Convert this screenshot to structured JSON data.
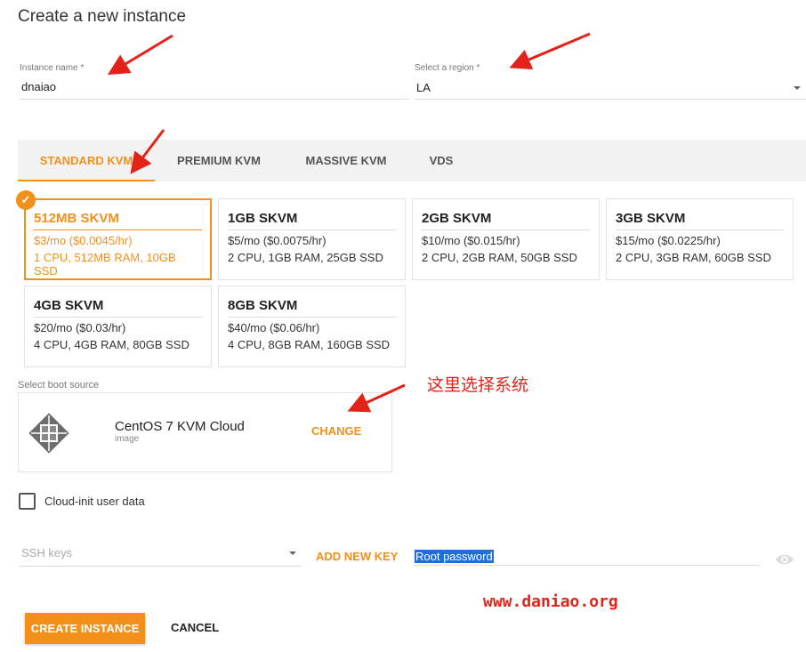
{
  "page": {
    "title": "Create a new instance"
  },
  "instance_name": {
    "label": "Instance name *",
    "value": "dnaiao"
  },
  "region": {
    "label": "Select a region *",
    "value": "LA"
  },
  "tabs": [
    {
      "label": "STANDARD KVM",
      "active": true
    },
    {
      "label": "PREMIUM KVM",
      "active": false
    },
    {
      "label": "MASSIVE KVM",
      "active": false
    },
    {
      "label": "VDS",
      "active": false
    }
  ],
  "plans": [
    {
      "name": "512MB SKVM",
      "price": "$3/mo ($0.0045/hr)",
      "specs": "1 CPU, 512MB RAM, 10GB SSD",
      "selected": true
    },
    {
      "name": "1GB SKVM",
      "price": "$5/mo ($0.0075/hr)",
      "specs": "2 CPU, 1GB RAM, 25GB SSD",
      "selected": false
    },
    {
      "name": "2GB SKVM",
      "price": "$10/mo ($0.015/hr)",
      "specs": "2 CPU, 2GB RAM, 50GB SSD",
      "selected": false
    },
    {
      "name": "3GB SKVM",
      "price": "$15/mo ($0.0225/hr)",
      "specs": "2 CPU, 3GB RAM, 60GB SSD",
      "selected": false
    },
    {
      "name": "4GB SKVM",
      "price": "$20/mo ($0.03/hr)",
      "specs": "4 CPU, 4GB RAM, 80GB SSD",
      "selected": false
    },
    {
      "name": "8GB SKVM",
      "price": "$40/mo ($0.06/hr)",
      "specs": "4 CPU, 8GB RAM, 160GB SSD",
      "selected": false
    }
  ],
  "boot_source": {
    "label": "Select boot source",
    "name": "CentOS 7 KVM Cloud",
    "type": "image",
    "change_label": "CHANGE",
    "icon": "centos-logo-icon"
  },
  "cloud_init": {
    "label": "Cloud-init user data",
    "checked": false
  },
  "ssh_keys": {
    "placeholder": "SSH keys",
    "add_label": "ADD NEW KEY"
  },
  "root_password": {
    "placeholder": "Root password"
  },
  "actions": {
    "create_label": "CREATE INSTANCE",
    "cancel_label": "CANCEL"
  },
  "annotations": {
    "note": "这里选择系统",
    "watermark": "www.daniao.org"
  },
  "colors": {
    "accent": "#f39019",
    "annotation": "#e3231a",
    "selection": "#1e6fd9"
  }
}
